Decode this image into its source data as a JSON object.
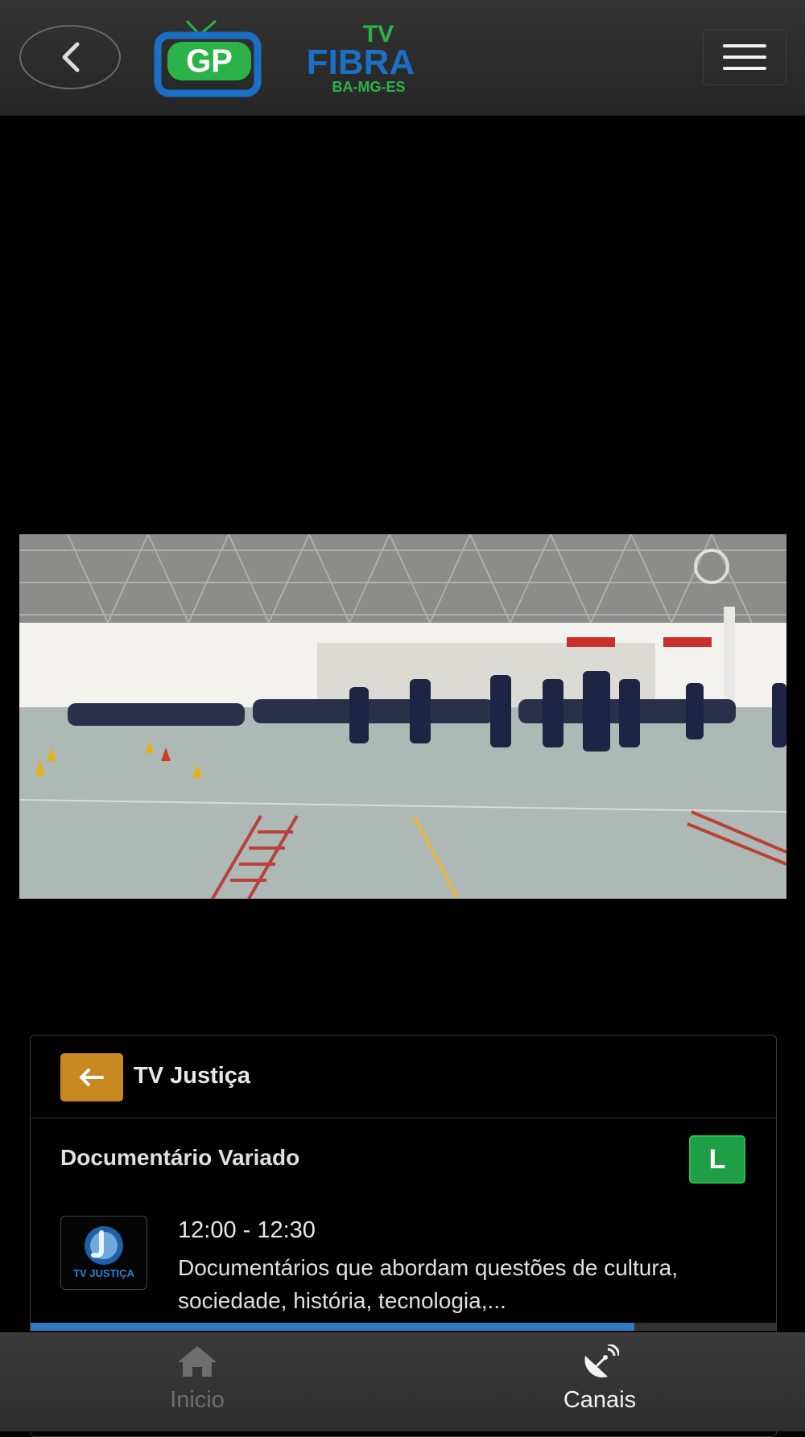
{
  "header": {
    "logo": {
      "mark": "GP",
      "line1": "TV",
      "line2": "FIBRA",
      "line3": "BA-MG-ES"
    }
  },
  "player": {},
  "channel": {
    "name": "TV Justiça",
    "logo_text": "TV JUSTIÇA"
  },
  "program": {
    "title": "Documentário Variado",
    "rating": "L",
    "time": "12:00 - 12:30",
    "description": "Documentários que abordam questões de cultura, sociedade, história, tecnologia,...",
    "progress": 0.81
  },
  "nav": {
    "home_label": "Inicio",
    "channels_label": "Canais"
  },
  "colors": {
    "accent_orange": "#c88820",
    "rating_green": "#1e9e45",
    "progress_blue": "#2f7ac0",
    "logo_blue": "#1b6fc4",
    "logo_green": "#2bb34a"
  }
}
